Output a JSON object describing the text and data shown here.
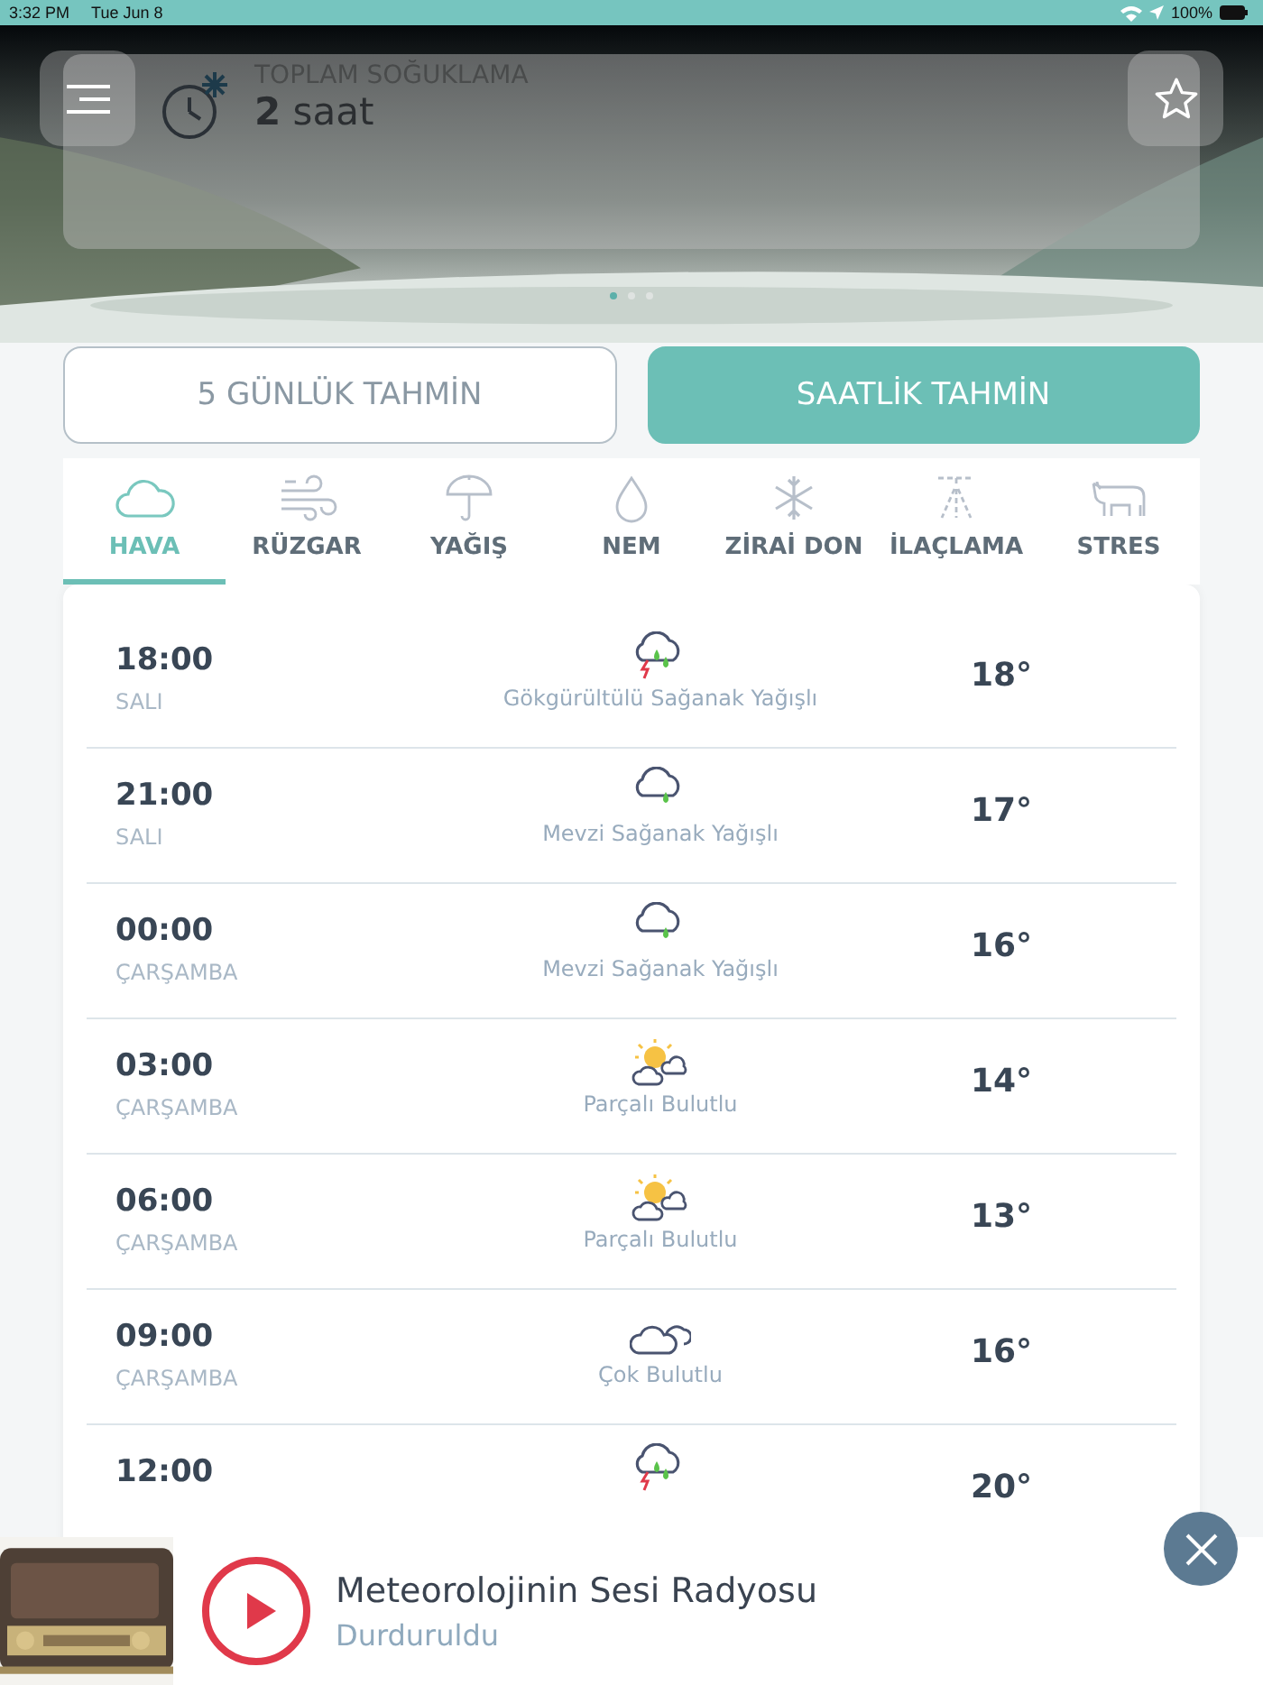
{
  "status_bar": {
    "time": "3:32 PM",
    "date": "Tue Jun 8",
    "battery": "100%"
  },
  "summary_card": {
    "title": "TOPLAM SOĞUKLAMA",
    "value": "**2** saat"
  },
  "pager": [
    {
      "selected": true
    },
    {
      "selected": false
    },
    {
      "selected": false
    }
  ],
  "mode_buttons": [
    {
      "label": "5 GÜNLÜK TAHMİN",
      "selected": false
    },
    {
      "label": "SAATLİK TAHMİN",
      "selected": true
    }
  ],
  "tabs": [
    {
      "label": "HAVA",
      "kind": "cloud",
      "selected": true
    },
    {
      "label": "RÜZGAR",
      "kind": "wind",
      "selected": false
    },
    {
      "label": "YAĞIŞ",
      "kind": "umbrella",
      "selected": false
    },
    {
      "label": "NEM",
      "kind": "drop",
      "selected": false
    },
    {
      "label": "ZİRAİ DON",
      "kind": "snow",
      "selected": false
    },
    {
      "label": "İLAÇLAMA",
      "kind": "spray",
      "selected": false
    },
    {
      "label": "STRES",
      "kind": "cow",
      "selected": false
    }
  ],
  "rows": [
    {
      "time": "18:00",
      "day": "SALI",
      "kind": "storm",
      "condition": "Gökgürültülü Sağanak Yağışlı",
      "temp": "18°"
    },
    {
      "time": "21:00",
      "day": "SALI",
      "kind": "rain",
      "condition": "Mevzi Sağanak Yağışlı",
      "temp": "17°"
    },
    {
      "time": "00:00",
      "day": "ÇARŞAMBA",
      "kind": "rain",
      "condition": "Mevzi Sağanak Yağışlı",
      "temp": "16°"
    },
    {
      "time": "03:00",
      "day": "ÇARŞAMBA",
      "kind": "partly",
      "condition": "Parçalı Bulutlu",
      "temp": "14°"
    },
    {
      "time": "06:00",
      "day": "ÇARŞAMBA",
      "kind": "partly",
      "condition": "Parçalı Bulutlu",
      "temp": "13°"
    },
    {
      "time": "09:00",
      "day": "ÇARŞAMBA",
      "kind": "cloudy",
      "condition": "Çok Bulutlu",
      "temp": "16°"
    },
    {
      "time": "12:00",
      "kind": "storm",
      "temp": "20°"
    }
  ],
  "player": {
    "title": "Meteorolojinin Sesi Radyosu",
    "status": "Durduruldu",
    "playing": false
  }
}
